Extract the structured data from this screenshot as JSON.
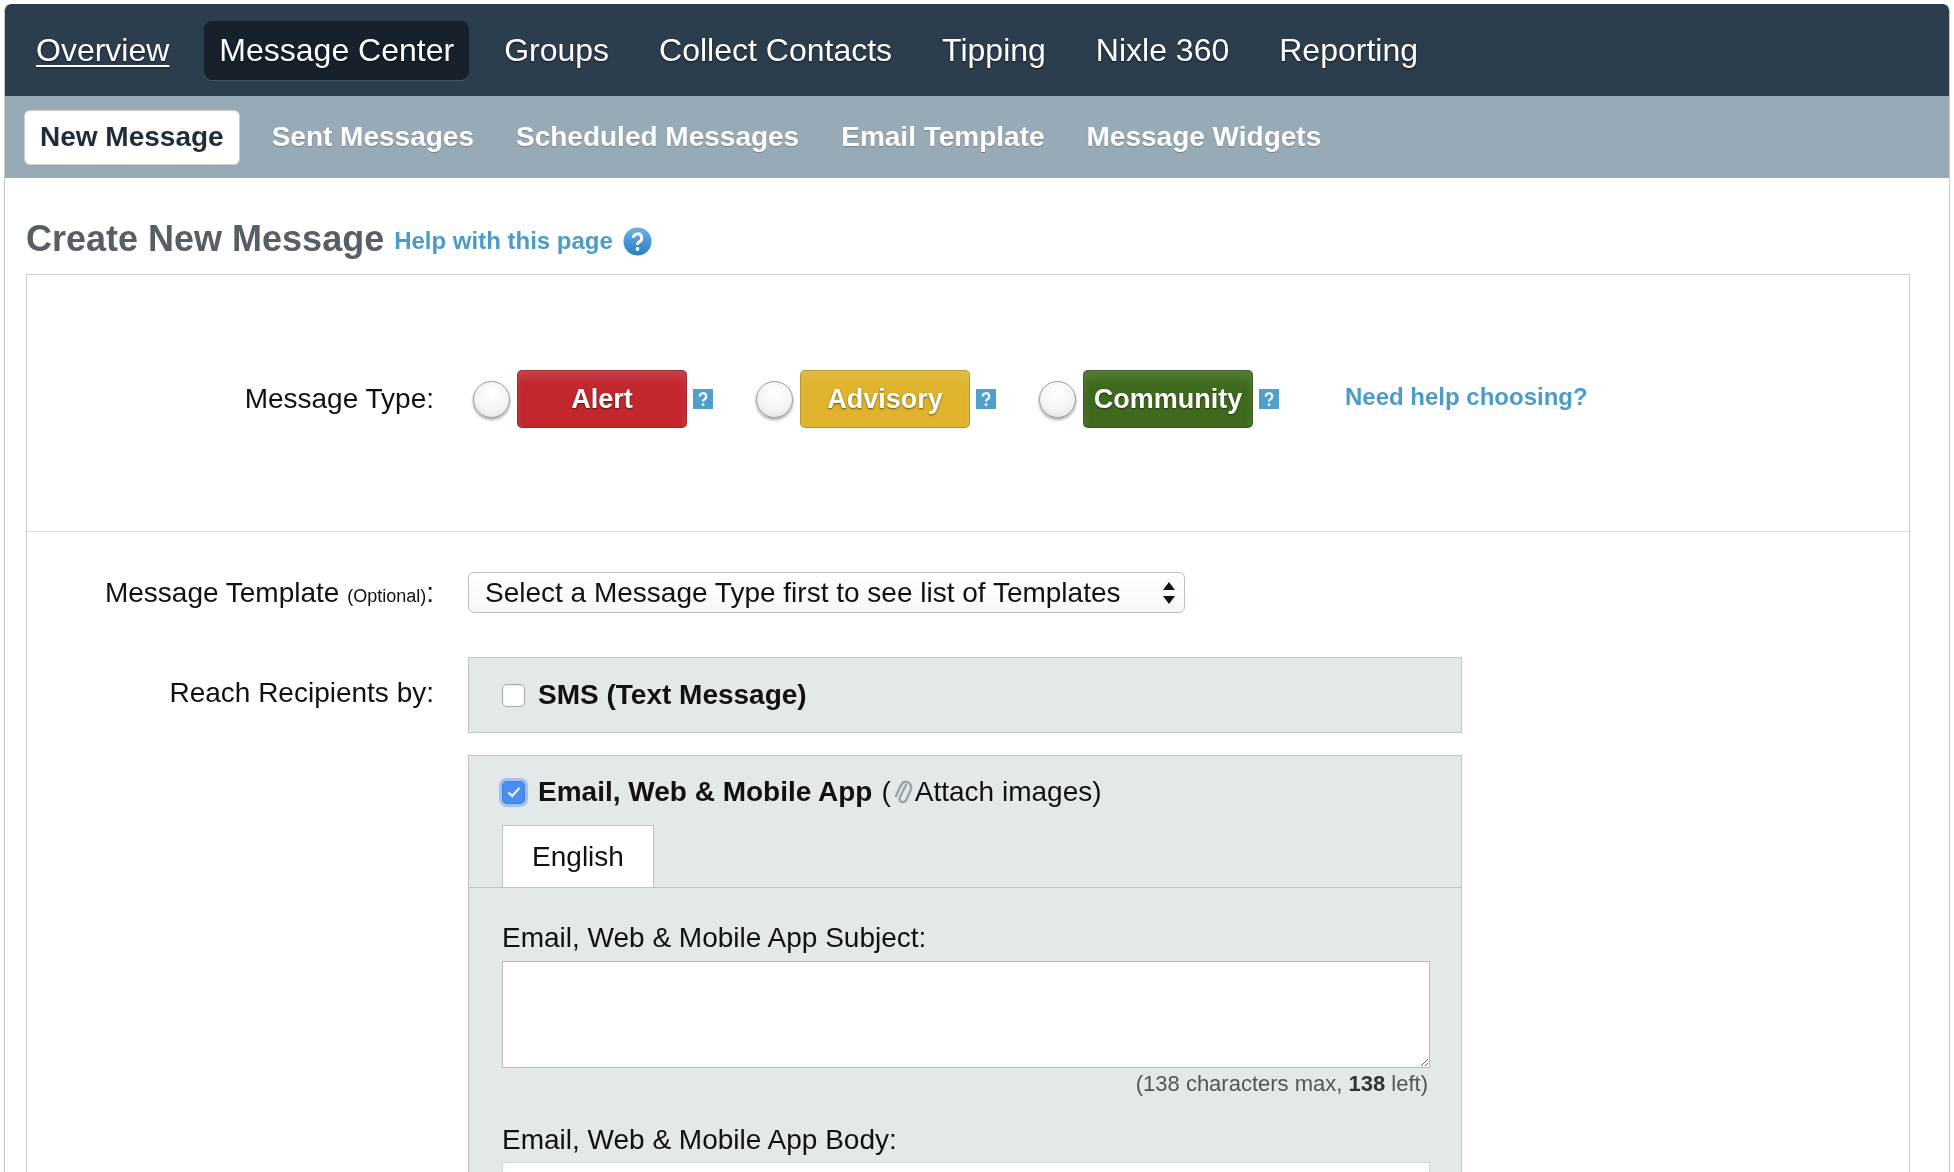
{
  "main_nav": [
    {
      "label": "Overview",
      "selected": false,
      "focused": true
    },
    {
      "label": "Message Center",
      "selected": true,
      "focused": false
    },
    {
      "label": "Groups",
      "selected": false,
      "focused": false
    },
    {
      "label": "Collect Contacts",
      "selected": false,
      "focused": false
    },
    {
      "label": "Tipping",
      "selected": false,
      "focused": false
    },
    {
      "label": "Nixle 360",
      "selected": false,
      "focused": false
    },
    {
      "label": "Reporting",
      "selected": false,
      "focused": false
    }
  ],
  "sub_nav": [
    {
      "label": "New Message",
      "selected": true
    },
    {
      "label": "Sent Messages",
      "selected": false
    },
    {
      "label": "Scheduled Messages",
      "selected": false
    },
    {
      "label": "Email Template",
      "selected": false
    },
    {
      "label": "Message Widgets",
      "selected": false
    }
  ],
  "page_header": {
    "title": "Create New Message",
    "help_link": "Help with this page"
  },
  "message_type": {
    "label": "Message Type:",
    "options": [
      {
        "label": "Alert",
        "selected": false,
        "color": "#c1272d"
      },
      {
        "label": "Advisory",
        "selected": false,
        "color": "#dfb32c"
      },
      {
        "label": "Community",
        "selected": false,
        "color": "#3f6a1d"
      }
    ],
    "help_link": "Need help choosing?"
  },
  "message_template": {
    "label": "Message Template",
    "note": "(Optional)",
    "label_end": ":",
    "value": "Select a Message Type first to see list of Templates"
  },
  "reach_recipients": {
    "label": "Reach Recipients by:",
    "channels": [
      {
        "kind": "sms",
        "label": "SMS (Text Message)",
        "checked": false
      },
      {
        "kind": "email",
        "label": "Email, Web & Mobile App",
        "checked": true,
        "attach": {
          "before": "(",
          "label": "Attach images",
          "after": ")"
        },
        "language_tabs": [
          {
            "label": "English",
            "selected": true
          }
        ],
        "subject": {
          "label": "Email, Web & Mobile App Subject:",
          "counter": "(138 characters max, **138** left)"
        },
        "body": {
          "label": "Email, Web & Mobile App Body:"
        }
      }
    ]
  }
}
